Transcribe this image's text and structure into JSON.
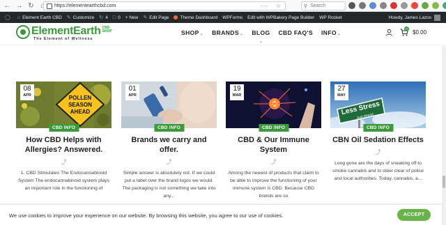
{
  "browser": {
    "url": "https://elementearthcbd.com",
    "search_placeholder": "Search"
  },
  "admin_bar": {
    "site_name": "Element Earth CBD",
    "customize": "Customize",
    "updates_count": "4",
    "comments_count": "0",
    "new_label": "+ New",
    "edit_page": "Edit Page",
    "theme_dashboard": "Theme Dashboard",
    "wpforms": "WPForms",
    "wpbakery": "Edit with WPBakery Page Builder",
    "wp_rocket": "WP Rocket",
    "howdy": "Howdy, James Lazos"
  },
  "header": {
    "logo_text": "ElementEarth",
    "logo_shop": "CBD SHOP",
    "tagline": "The Element of Wellness",
    "nav": [
      {
        "label": "SHOP",
        "has_caret": true
      },
      {
        "label": "BRANDS",
        "has_caret": true
      },
      {
        "label": "BLOG",
        "has_caret": false
      },
      {
        "label": "CBD FAQ'S",
        "has_caret": false
      },
      {
        "label": "INFO",
        "has_caret": true
      }
    ],
    "cart_count": "0",
    "cart_total": "$0.00"
  },
  "posts": [
    {
      "day": "08",
      "month": "APR",
      "category": "CBD INFO",
      "title": "How CBD Helps with Allergies? Answered.",
      "excerpt": "1. CBD Stimulates The Endocannabinoid System The endocannabinoid system plays an important role in the functioning of",
      "image_sign_text": "POLLEN SEASON AHEAD"
    },
    {
      "day": "01",
      "month": "APR",
      "category": "CBD INFO",
      "title": "Brands we carry and offer.",
      "excerpt": "Simple answer is absolutely not. If we could put a label over the brand logos we would. The packaging is not something we take into any..."
    },
    {
      "day": "19",
      "month": "MAR",
      "category": "CBD INFO",
      "title": "CBD & Our Immune System",
      "excerpt": "Among the newest of products that claim to be able to improve the functioning of your immune system is CBD. Because CBD brands are so"
    },
    {
      "day": "27",
      "month": "MAY",
      "category": "CBD INFO",
      "title": "CBN Oil Sedation Effects",
      "excerpt": "Long gone are the days of sneaking off to smoke cannabis and to steer clear of police and local authorities. Today, cannabis, a...",
      "image_sign_text": "Less Stress",
      "image_sign_subtext": "Just Ahead"
    }
  ],
  "cookie": {
    "text": "We use cookies to improve your experience on our website. By browsing this website, you agree to our use of cookies.",
    "accept_label": "ACCEPT"
  },
  "colors": {
    "brand_green": "#3b9b3a",
    "accept_green": "#6ab34a",
    "admin_bar": "#23282d"
  }
}
